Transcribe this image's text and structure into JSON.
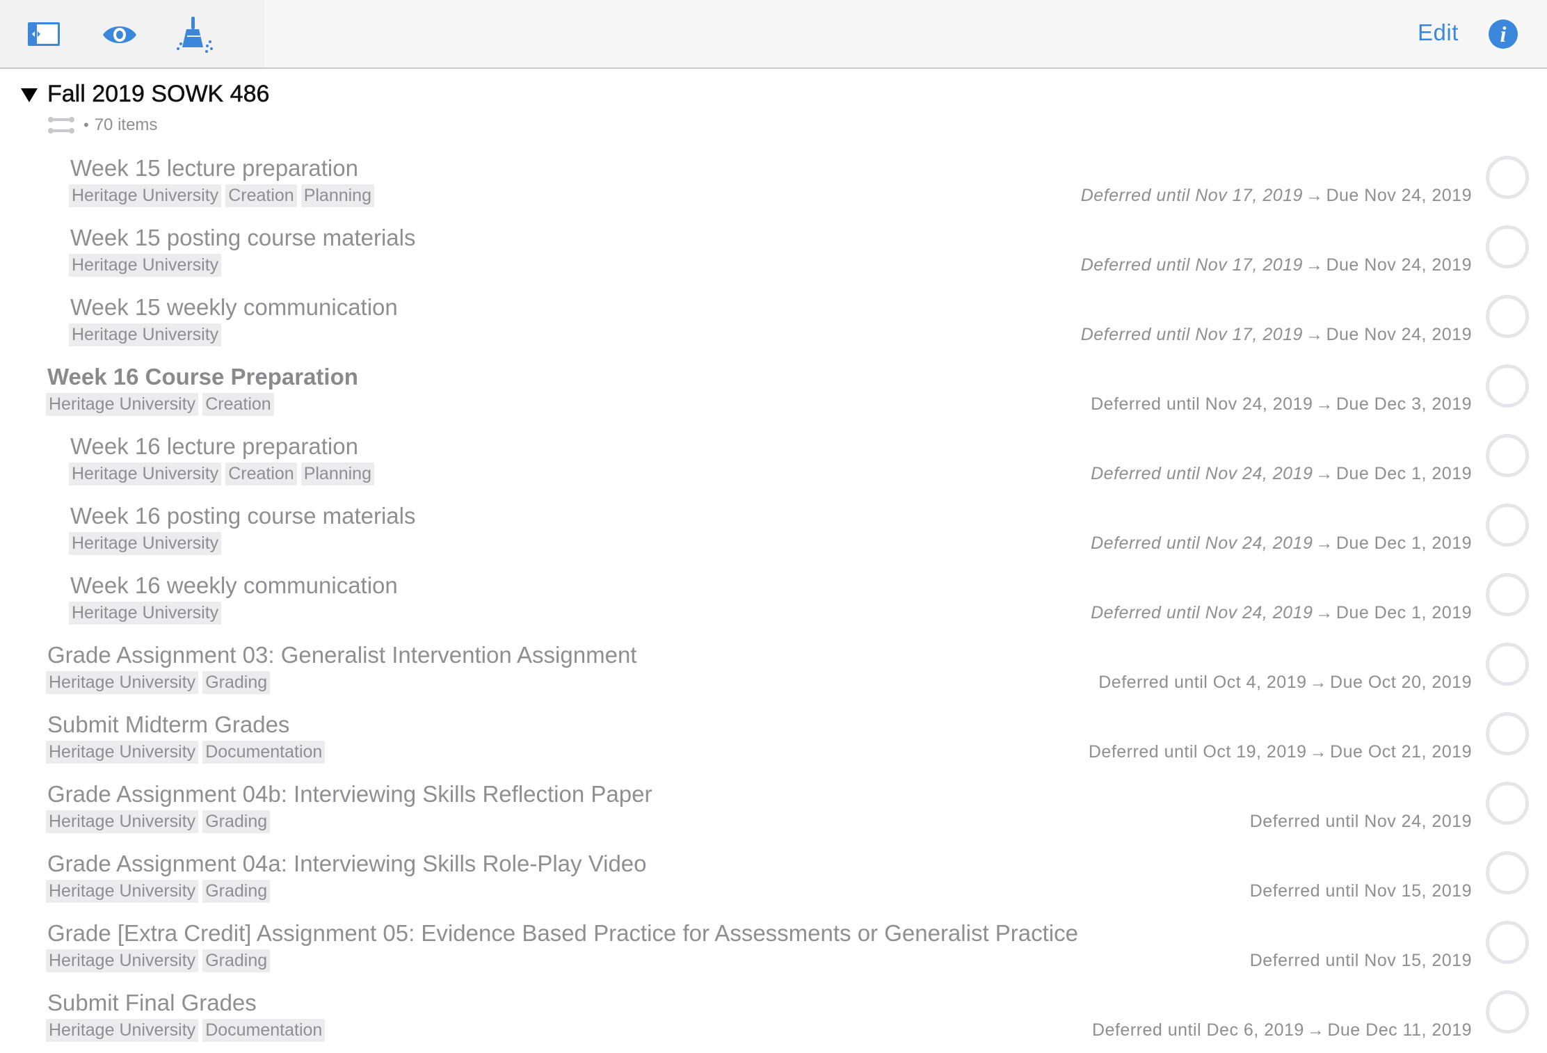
{
  "toolbar": {
    "edit_label": "Edit",
    "info_label": "i",
    "accent_color": "#3b87dc",
    "icons": [
      "sidebar-toggle-icon",
      "eye-icon",
      "broom-icon",
      "info-icon"
    ]
  },
  "project": {
    "title": "Fall 2019 SOWK 486",
    "dot": "•",
    "count_label": "70 items"
  },
  "tasks": [
    {
      "title": "Week 15 lecture preparation",
      "tags": [
        "Heritage University",
        "Creation",
        "Planning"
      ],
      "defer": "Deferred until Nov 17, 2019",
      "defer_inherited": true,
      "arrow": "→",
      "due": "Due Nov 24, 2019",
      "indent": 1
    },
    {
      "title": "Week 15 posting course materials",
      "tags": [
        "Heritage University"
      ],
      "defer": "Deferred until Nov 17, 2019",
      "defer_inherited": true,
      "arrow": "→",
      "due": "Due Nov 24, 2019",
      "indent": 1
    },
    {
      "title": "Week 15 weekly communication",
      "tags": [
        "Heritage University"
      ],
      "defer": "Deferred until Nov 17, 2019",
      "defer_inherited": true,
      "arrow": "→",
      "due": "Due Nov 24, 2019",
      "indent": 1
    },
    {
      "title": "Week 16 Course Preparation",
      "tags": [
        "Heritage University",
        "Creation"
      ],
      "defer": "Deferred until Nov 24, 2019",
      "defer_inherited": false,
      "arrow": "→",
      "due": "Due Dec 3, 2019",
      "indent": 0,
      "group": true
    },
    {
      "title": "Week 16 lecture preparation",
      "tags": [
        "Heritage University",
        "Creation",
        "Planning"
      ],
      "defer": "Deferred until Nov 24, 2019",
      "defer_inherited": true,
      "arrow": "→",
      "due": "Due Dec 1, 2019",
      "indent": 1
    },
    {
      "title": "Week 16 posting course materials",
      "tags": [
        "Heritage University"
      ],
      "defer": "Deferred until Nov 24, 2019",
      "defer_inherited": true,
      "arrow": "→",
      "due": "Due Dec 1, 2019",
      "indent": 1
    },
    {
      "title": "Week 16 weekly communication",
      "tags": [
        "Heritage University"
      ],
      "defer": "Deferred until Nov 24, 2019",
      "defer_inherited": true,
      "arrow": "→",
      "due": "Due Dec 1, 2019",
      "indent": 1
    },
    {
      "title": "Grade Assignment 03: Generalist Intervention Assignment",
      "tags": [
        "Heritage University",
        "Grading"
      ],
      "defer": "Deferred until Oct 4, 2019",
      "defer_inherited": false,
      "arrow": "→",
      "due": "Due Oct 20, 2019",
      "indent": 0
    },
    {
      "title": "Submit Midterm Grades",
      "tags": [
        "Heritage University",
        "Documentation"
      ],
      "defer": "Deferred until Oct 19, 2019",
      "defer_inherited": false,
      "arrow": "→",
      "due": "Due Oct 21, 2019",
      "indent": 0
    },
    {
      "title": "Grade Assignment 04b: Interviewing Skills Reflection Paper",
      "tags": [
        "Heritage University",
        "Grading"
      ],
      "defer": "Deferred until Nov 24, 2019",
      "defer_inherited": false,
      "arrow": "",
      "due": "",
      "indent": 0
    },
    {
      "title": "Grade Assignment 04a: Interviewing Skills Role-Play Video",
      "tags": [
        "Heritage University",
        "Grading"
      ],
      "defer": "Deferred until Nov 15, 2019",
      "defer_inherited": false,
      "arrow": "",
      "due": "",
      "indent": 0
    },
    {
      "title": "Grade [Extra Credit] Assignment 05: Evidence Based Practice for Assessments or Generalist Practice",
      "tags": [
        "Heritage University",
        "Grading"
      ],
      "defer": "Deferred until Nov 15, 2019",
      "defer_inherited": false,
      "arrow": "",
      "due": "",
      "indent": 0
    },
    {
      "title": "Submit Final Grades",
      "tags": [
        "Heritage University",
        "Documentation"
      ],
      "defer": "Deferred until Dec 6, 2019",
      "defer_inherited": false,
      "arrow": "→",
      "due": "Due Dec 11, 2019",
      "indent": 0
    }
  ]
}
